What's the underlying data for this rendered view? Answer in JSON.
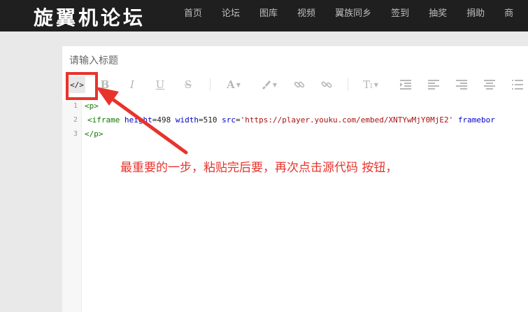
{
  "site": {
    "logo_text": "旋翼机论坛",
    "nav": [
      "首页",
      "论坛",
      "图库",
      "视频",
      "翼族同乡",
      "签到",
      "抽奖",
      "捐助",
      "商"
    ]
  },
  "editor": {
    "title_placeholder": "请输入标题",
    "toolbar_icons": [
      "source-code-icon",
      "bold-icon",
      "italic-icon",
      "underline-icon",
      "strikethrough-icon",
      "font-color-icon",
      "highlight-brush-icon",
      "link-icon",
      "unlink-icon",
      "font-size-icon",
      "indent-icon",
      "align-left-icon",
      "align-right-icon",
      "align-center-icon",
      "list-icon"
    ],
    "line_numbers": [
      "1",
      "2",
      "3"
    ],
    "code": {
      "line1_tag": "<p>",
      "line2_open": "<iframe ",
      "line2_attr_height": "height",
      "line2_eq1": "=498 ",
      "line2_attr_width": "width",
      "line2_eq2": "=510 ",
      "line2_attr_src": "src",
      "line2_eq3": "=",
      "line2_src_value": "'https://player.youku.com/embed/XNTYwMjY0MjE2'",
      "line2_attr_frameborder": " framebor",
      "line3_tag": "</p>"
    }
  },
  "annotation": {
    "text": "最重要的一步，粘贴完后要，再次点击源代码 按钮，",
    "color": "#e8332c"
  },
  "colors": {
    "topbar": "#1f1f1f",
    "highlight_red": "#e8332c"
  }
}
